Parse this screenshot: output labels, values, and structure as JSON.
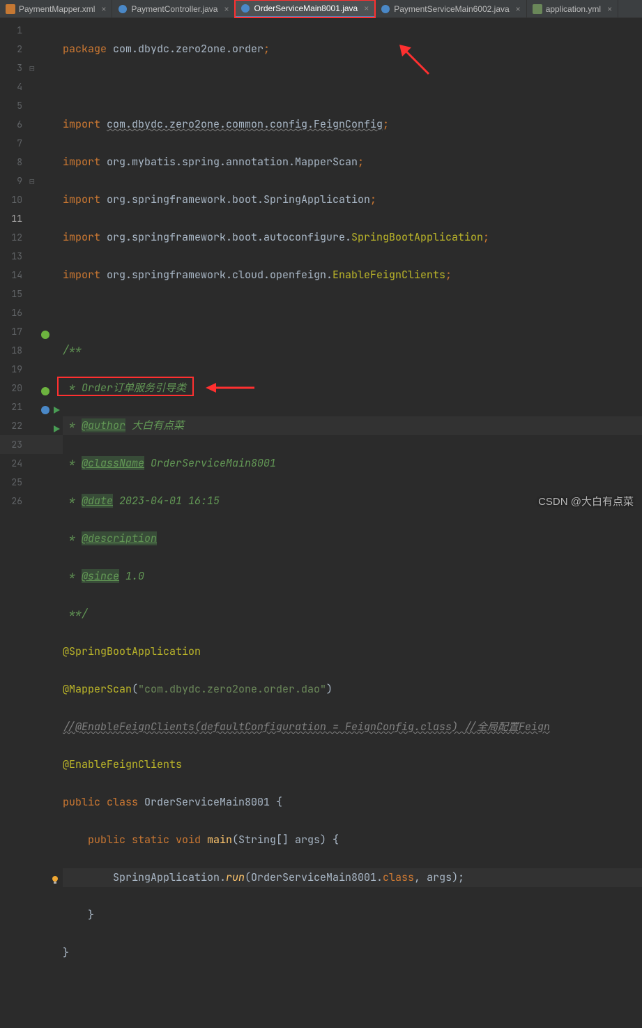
{
  "tabs": [
    {
      "label": "PaymentMapper.xml",
      "icon": "xml",
      "active": false
    },
    {
      "label": "PaymentController.java",
      "icon": "java",
      "active": false
    },
    {
      "label": "OrderServiceMain8001.java",
      "icon": "java",
      "active": true,
      "highlight": true
    },
    {
      "label": "PaymentServiceMain6002.java",
      "icon": "java",
      "active": false
    },
    {
      "label": "application.yml",
      "icon": "yml",
      "active": false
    }
  ],
  "code": {
    "l1_a": "package ",
    "l1_b": "com.dbydc.zero2one.order",
    "l3_a": "import ",
    "l3_b": "com.dbydc.zero2one.common.config.FeignConfig",
    "l4_a": "import ",
    "l4_b": "org.mybatis.spring.annotation.",
    "l4_c": "MapperScan",
    "l5_a": "import ",
    "l5_b": "org.springframework.boot.",
    "l5_c": "SpringApplication",
    "l6_a": "import ",
    "l6_b": "org.springframework.boot.autoconfigure.",
    "l6_c": "SpringBootApplication",
    "l7_a": "import ",
    "l7_b": "org.springframework.cloud.openfeign.",
    "l7_c": "EnableFeignClients",
    "l9": "/**",
    "l10": " * Order订单服务引导类",
    "l11_a": " * ",
    "l11_b": "@author",
    "l11_c": " 大白有点菜",
    "l12_a": " * ",
    "l12_b": "@className",
    "l12_c": " OrderServiceMain8001",
    "l13_a": " * ",
    "l13_b": "@date",
    "l13_c": " 2023-04-01 16:15",
    "l14_a": " * ",
    "l14_b": "@description",
    "l15_a": " * ",
    "l15_b": "@since",
    "l15_c": " 1.0",
    "l16": " **/",
    "l17": "@SpringBootApplication",
    "l18_a": "@MapperScan",
    "l18_b": "(",
    "l18_c": "\"com.dbydc.zero2one.order.dao\"",
    "l18_d": ")",
    "l19": "//@EnableFeignClients(defaultConfiguration = FeignConfig.class) //全局配置Feign",
    "l20": "@EnableFeignClients",
    "l21_a": "public class ",
    "l21_b": "OrderServiceMain8001",
    " l21_c": " {",
    "l22_a": "    public static void ",
    "l22_b": "main",
    "l22_c": "(String[] args) {",
    "l23_a": "        SpringApplication.",
    "l23_b": "run",
    "l23_c": "(OrderServiceMain8001.",
    "l23_d": "class",
    "l23_e": ", args);",
    "l24": "    }",
    "l25": "}"
  },
  "watermark": "CSDN @大白有点菜"
}
